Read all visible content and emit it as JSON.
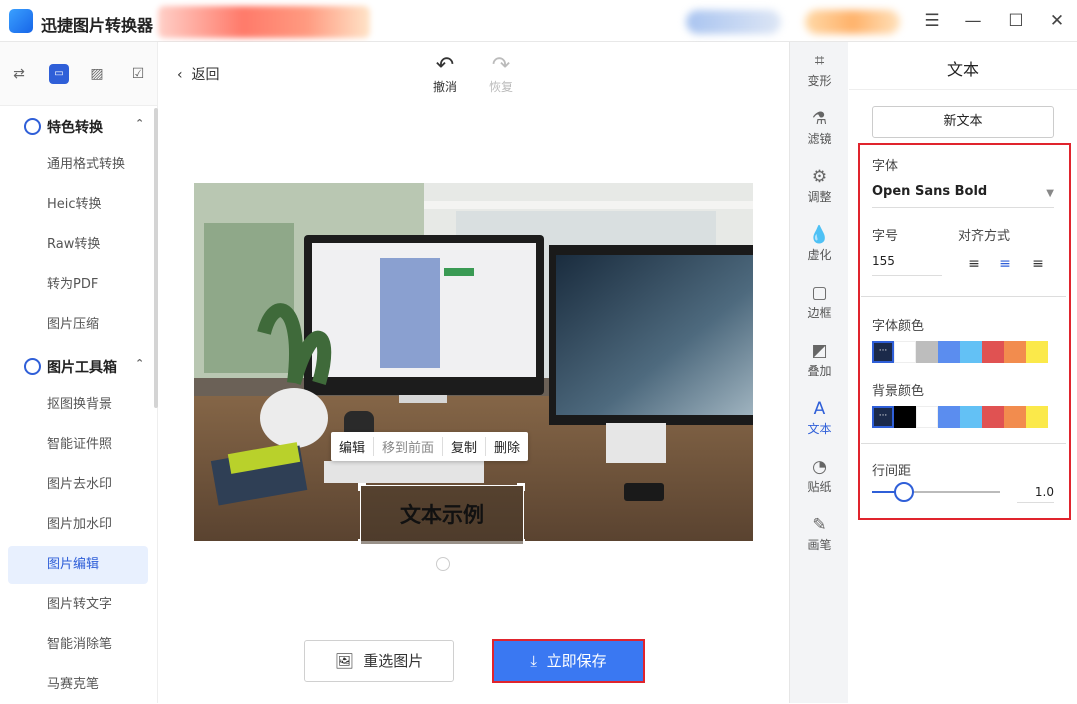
{
  "app": {
    "title": "迅捷图片转换器"
  },
  "sidebar": {
    "tabs": [
      "convert-icon",
      "toolbox-icon",
      "image-icon",
      "check-icon"
    ],
    "groups": [
      {
        "label": "特色转换",
        "items": [
          "通用格式转换",
          "Heic转换",
          "Raw转换",
          "转为PDF",
          "图片压缩"
        ]
      },
      {
        "label": "图片工具箱",
        "items": [
          "抠图换背景",
          "智能证件照",
          "图片去水印",
          "图片加水印",
          "图片编辑",
          "图片转文字",
          "智能消除笔",
          "马赛克笔"
        ]
      }
    ],
    "active_item": "图片编辑"
  },
  "main": {
    "back_label": "返回",
    "undo_label": "撤消",
    "redo_label": "恢复",
    "ctx_menu": [
      "编辑",
      "移到前面",
      "复制",
      "删除"
    ],
    "text_box": "文本示例",
    "reselect_label": "重选图片",
    "save_label": "立即保存"
  },
  "tools": [
    "变形",
    "滤镜",
    "调整",
    "虚化",
    "边框",
    "叠加",
    "文本",
    "贴纸",
    "画笔"
  ],
  "active_tool": "文本",
  "panel": {
    "title": "文本",
    "new_text_label": "新文本",
    "font_label": "字体",
    "font_value": "Open Sans Bold",
    "size_label": "字号",
    "size_value": "155",
    "align_label": "对齐方式",
    "align_active": "center",
    "font_color_label": "字体颜色",
    "font_colors": [
      "#1b2a4a",
      "#ffffff",
      "#bdbdbd",
      "#5b8def",
      "#63c1f5",
      "#e05252",
      "#f28c4e",
      "#fbe94a"
    ],
    "bg_color_label": "背景颜色",
    "bg_colors": [
      "#1b2a4a",
      "#000000",
      "#ffffff",
      "#5b8def",
      "#63c1f5",
      "#e05252",
      "#f28c4e",
      "#fbe94a"
    ],
    "line_spacing_label": "行间距",
    "line_spacing_value": "1.0",
    "line_spacing_fraction": 0.25
  },
  "colors": {
    "accent": "#2f5fd8",
    "save_bg": "#3a78f2",
    "highlight": "#e0242d"
  }
}
